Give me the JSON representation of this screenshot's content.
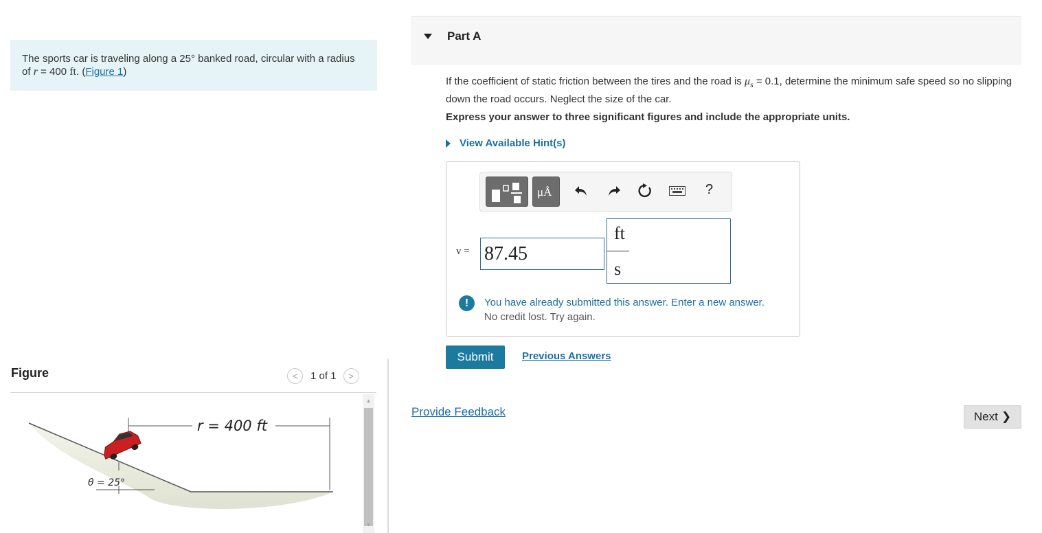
{
  "problem": {
    "text_prefix": "The sports car is traveling along a 25° banked road, circular with a radius of ",
    "r_symbol": "r",
    "r_eq": " = 400 ",
    "r_unit": "ft",
    "period_open": ". (",
    "figure_link": "Figure 1",
    "close_paren": ")"
  },
  "figure": {
    "title": "Figure",
    "pager_label": "1 of 1",
    "prev_glyph": "<",
    "next_glyph": ">",
    "radius_label": "r = 400 ft",
    "angle_label": "θ = 25°"
  },
  "part": {
    "title": "Part A",
    "question_prefix": "If the coefficient of static friction between the tires and the road is ",
    "mu_symbol": "μ",
    "mu_sub": "s",
    "question_suffix": " = 0.1, determine the minimum safe speed so no slipping down the road occurs. Neglect the size of the car.",
    "instruction": "Express your answer to three significant figures and include the appropriate units.",
    "hints_label": "View Available Hint(s)"
  },
  "toolbar": {
    "unit_button_label": "μÅ",
    "help_label": "?"
  },
  "answer": {
    "var_label": "v =",
    "value": "87.45",
    "unit_numerator": "ft",
    "unit_denominator": "s"
  },
  "feedback": {
    "line1": "You have already submitted this answer. Enter a new answer.",
    "line2": "No credit lost. Try again."
  },
  "actions": {
    "submit_label": "Submit",
    "previous_answers_label": "Previous Answers",
    "provide_feedback_label": "Provide Feedback",
    "next_label": "Next"
  },
  "colors": {
    "accent": "#1b7a9e",
    "link": "#1b6fa5",
    "problem_bg": "#e6f4f7"
  }
}
